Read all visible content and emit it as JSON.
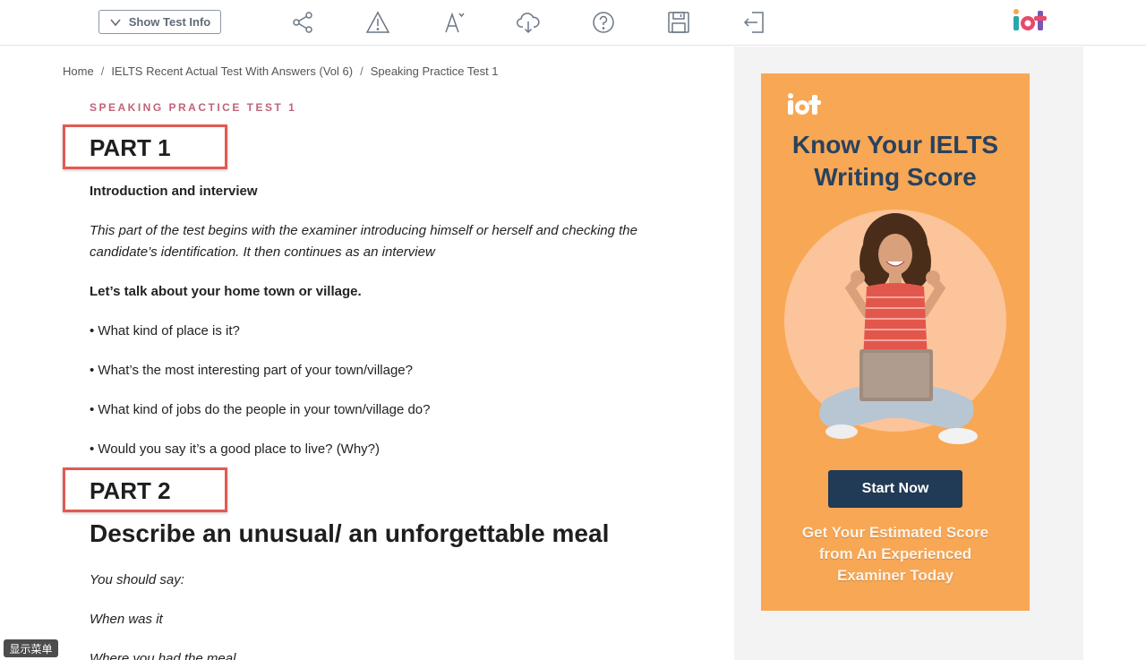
{
  "toolbar": {
    "show_info_label": "Show Test Info",
    "icons": [
      "share-icon",
      "warning-icon",
      "font-size-icon",
      "cloud-download-icon",
      "help-icon",
      "save-icon",
      "exit-icon"
    ]
  },
  "breadcrumb": {
    "items": [
      "Home",
      "IELTS Recent Actual Test With Answers (Vol 6)",
      "Speaking Practice Test 1"
    ],
    "separator": "/"
  },
  "article": {
    "eyebrow": "SPEAKING PRACTICE TEST 1",
    "part1_title": "PART 1",
    "intro_heading": "Introduction and interview",
    "intro_text": "This part of the test begins with the examiner introducing himself or herself and checking the candidate’s identification. It then continues as an interview",
    "topic_question": "Let’s talk about your home town or village.",
    "bullets": [
      "• What kind of place is it?",
      "• What’s the most interesting part of your town/village?",
      "• What kind of jobs do the people in your town/village do?",
      "• Would you say it’s a good place to live? (Why?)"
    ],
    "part2_title": "PART 2",
    "part2_heading": "Describe an unusual/ an unforgettable meal",
    "you_should_say": "You should say:",
    "prompts": [
      "When was it",
      "Where you had the meal"
    ]
  },
  "ad": {
    "title_line1": "Know Your IELTS",
    "title_line2": "Writing Score",
    "button_label": "Start Now",
    "sub_line1": "Get Your Estimated Score",
    "sub_line2": "from An Experienced",
    "sub_line3": "Examiner Today",
    "colors": {
      "background": "#f8a755",
      "title": "#28425e",
      "button": "#213a55"
    }
  },
  "floating": {
    "menu_label": "显示菜单"
  },
  "colors": {
    "eyebrow": "#c0627a",
    "highlight_box": "#e25a52"
  }
}
